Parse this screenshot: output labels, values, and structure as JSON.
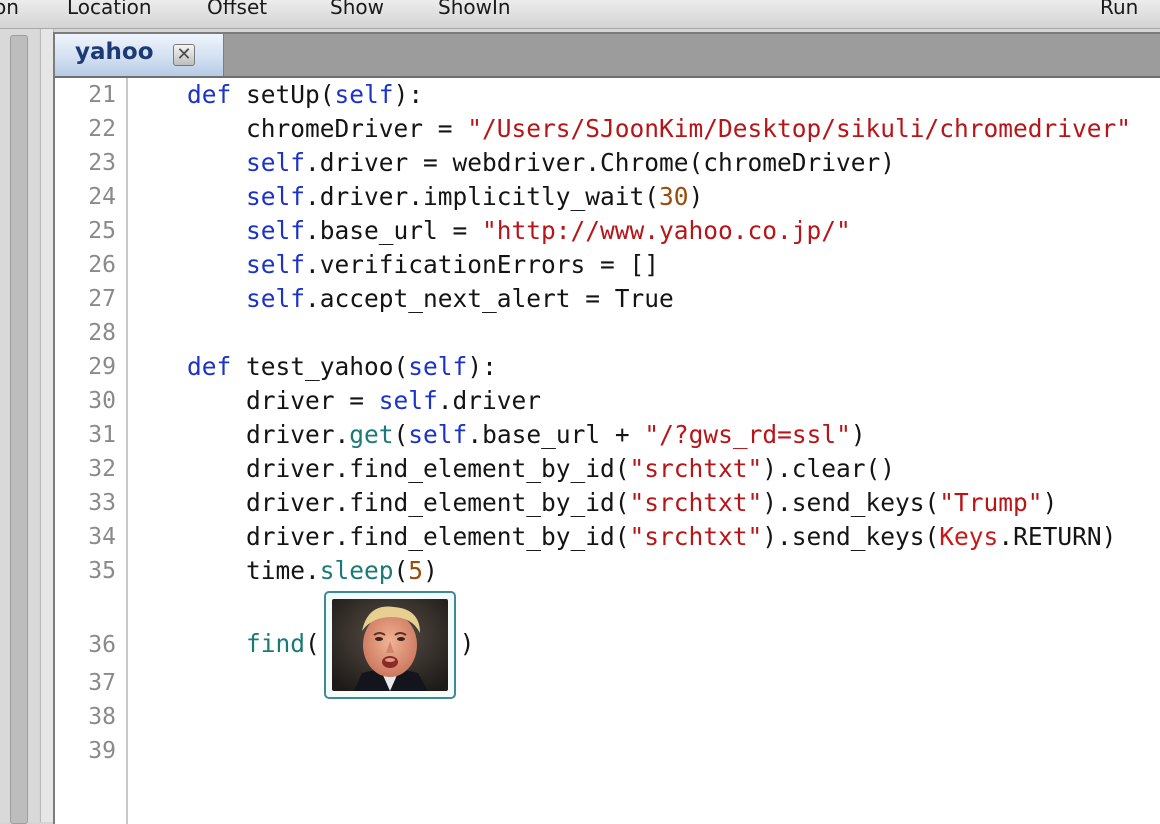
{
  "toolbar": {
    "items": [
      "on",
      "Location",
      "Offset",
      "Show",
      "ShowIn",
      "Run"
    ]
  },
  "tab": {
    "label": "yahoo",
    "close_glyph": "✕"
  },
  "editor": {
    "line_numbers": [
      "21",
      "22",
      "23",
      "24",
      "25",
      "26",
      "27",
      "28",
      "29",
      "30",
      "31",
      "32",
      "33",
      "34",
      "35",
      "36",
      "37",
      "38",
      "39"
    ],
    "lines": [
      [
        {
          "t": "    "
        },
        {
          "t": "def",
          "c": "kw"
        },
        {
          "t": " setUp("
        },
        {
          "t": "self",
          "c": "kw"
        },
        {
          "t": "):"
        }
      ],
      [
        {
          "t": "        chromeDriver = "
        },
        {
          "t": "\"/Users/SJoonKim/Desktop/sikuli/chromedriver\"",
          "c": "str"
        }
      ],
      [
        {
          "t": "        "
        },
        {
          "t": "self",
          "c": "kw"
        },
        {
          "t": ".driver = webdriver.Chrome(chromeDriver)"
        }
      ],
      [
        {
          "t": "        "
        },
        {
          "t": "self",
          "c": "kw"
        },
        {
          "t": ".driver.implicitly_wait("
        },
        {
          "t": "30",
          "c": "num"
        },
        {
          "t": ")"
        }
      ],
      [
        {
          "t": "        "
        },
        {
          "t": "self",
          "c": "kw"
        },
        {
          "t": ".base_url = "
        },
        {
          "t": "\"http://www.yahoo.co.jp/\"",
          "c": "str"
        }
      ],
      [
        {
          "t": "        "
        },
        {
          "t": "self",
          "c": "kw"
        },
        {
          "t": ".verificationErrors = []"
        }
      ],
      [
        {
          "t": "        "
        },
        {
          "t": "self",
          "c": "kw"
        },
        {
          "t": ".accept_next_alert = True"
        }
      ],
      [],
      [
        {
          "t": "    "
        },
        {
          "t": "def",
          "c": "kw"
        },
        {
          "t": " test_yahoo("
        },
        {
          "t": "self",
          "c": "kw"
        },
        {
          "t": "):"
        }
      ],
      [
        {
          "t": "        driver = "
        },
        {
          "t": "self",
          "c": "kw"
        },
        {
          "t": ".driver"
        }
      ],
      [
        {
          "t": "        driver."
        },
        {
          "t": "get",
          "c": "fn"
        },
        {
          "t": "("
        },
        {
          "t": "self",
          "c": "kw"
        },
        {
          "t": ".base_url + "
        },
        {
          "t": "\"/?gws_rd=ssl\"",
          "c": "str"
        },
        {
          "t": ")"
        }
      ],
      [
        {
          "t": "        driver.find_element_by_id("
        },
        {
          "t": "\"srchtxt\"",
          "c": "str"
        },
        {
          "t": ").clear()"
        }
      ],
      [
        {
          "t": "        driver.find_element_by_id("
        },
        {
          "t": "\"srchtxt\"",
          "c": "str"
        },
        {
          "t": ").send_keys("
        },
        {
          "t": "\"Trump\"",
          "c": "str"
        },
        {
          "t": ")"
        }
      ],
      [
        {
          "t": "        driver.find_element_by_id("
        },
        {
          "t": "\"srchtxt\"",
          "c": "str"
        },
        {
          "t": ").send_keys("
        },
        {
          "t": "Keys",
          "c": "red"
        },
        {
          "t": ".RETURN)"
        }
      ],
      [
        {
          "t": "        time."
        },
        {
          "t": "sleep",
          "c": "fn"
        },
        {
          "t": "("
        },
        {
          "t": "5",
          "c": "num"
        },
        {
          "t": ")"
        }
      ]
    ],
    "find_line": {
      "prefix": "        ",
      "call": "find",
      "open": "(",
      "close": ")",
      "image_icon": "portrait-photo-icon"
    }
  }
}
